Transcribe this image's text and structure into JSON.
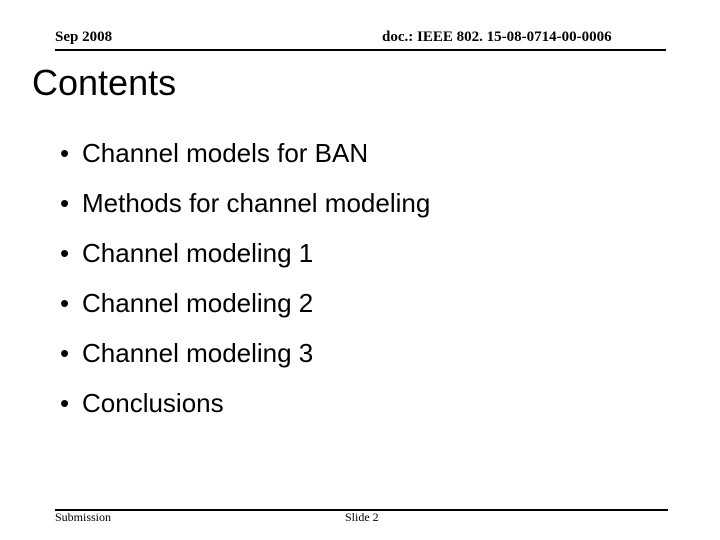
{
  "header": {
    "date": "Sep 2008",
    "doc_id": "doc.: IEEE 802. 15-08-0714-00-0006"
  },
  "slide": {
    "title": "Contents",
    "bullet_icon": "bullet-dot",
    "bullet_glyph": "•",
    "bullets": [
      "Channel models for BAN",
      "Methods for channel modeling",
      "Channel modeling 1",
      "Channel modeling 2",
      "Channel modeling 3",
      "Conclusions"
    ]
  },
  "footer": {
    "left": "Submission",
    "slide_number": "Slide 2"
  }
}
